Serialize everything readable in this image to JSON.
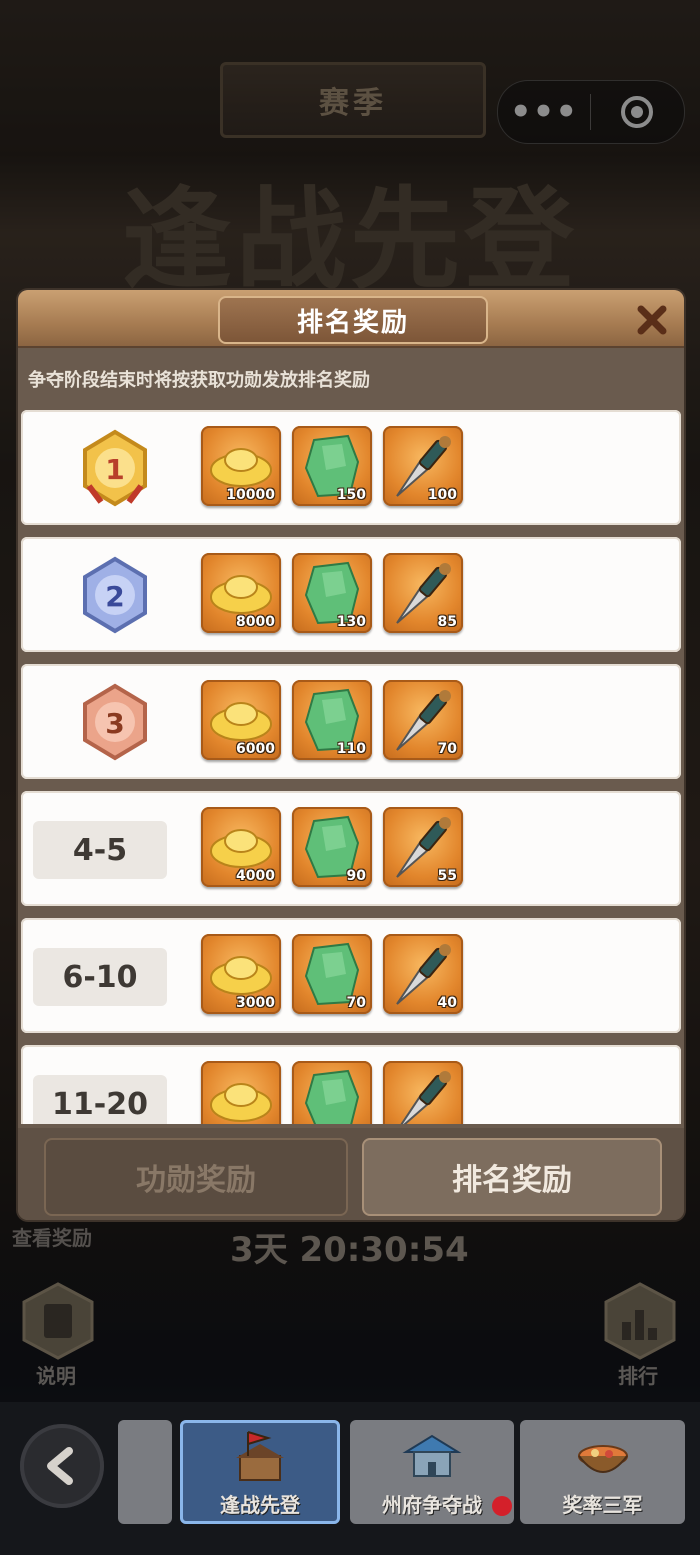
{
  "header": {
    "season_title": "赛季",
    "event_title": "逢战先登",
    "menu_dots": "•••"
  },
  "modal": {
    "title": "排名奖励",
    "description": "争夺阶段结束时将按获取功勋发放排名奖励",
    "rows": [
      {
        "rank": "1",
        "rewards": [
          {
            "item": "gold-ingot-icon",
            "qty": "10000"
          },
          {
            "item": "jade-stone-icon",
            "qty": "150"
          },
          {
            "item": "dagger-icon",
            "qty": "100"
          }
        ]
      },
      {
        "rank": "2",
        "rewards": [
          {
            "item": "gold-ingot-icon",
            "qty": "8000"
          },
          {
            "item": "jade-stone-icon",
            "qty": "130"
          },
          {
            "item": "dagger-icon",
            "qty": "85"
          }
        ]
      },
      {
        "rank": "3",
        "rewards": [
          {
            "item": "gold-ingot-icon",
            "qty": "6000"
          },
          {
            "item": "jade-stone-icon",
            "qty": "110"
          },
          {
            "item": "dagger-icon",
            "qty": "70"
          }
        ]
      },
      {
        "rank": "4-5",
        "rewards": [
          {
            "item": "gold-ingot-icon",
            "qty": "4000"
          },
          {
            "item": "jade-stone-icon",
            "qty": "90"
          },
          {
            "item": "dagger-icon",
            "qty": "55"
          }
        ]
      },
      {
        "rank": "6-10",
        "rewards": [
          {
            "item": "gold-ingot-icon",
            "qty": "3000"
          },
          {
            "item": "jade-stone-icon",
            "qty": "70"
          },
          {
            "item": "dagger-icon",
            "qty": "40"
          }
        ]
      },
      {
        "rank": "11-20",
        "rewards": [
          {
            "item": "gold-ingot-icon",
            "qty": ""
          },
          {
            "item": "jade-stone-icon",
            "qty": ""
          },
          {
            "item": "dagger-icon",
            "qty": ""
          }
        ]
      }
    ],
    "tabs": {
      "merit": "功勋奖励",
      "ranking": "排名奖励"
    }
  },
  "below_modal": {
    "view_rewards": "查看奖励",
    "countdown": "3天 20:30:54",
    "help_label": "说明",
    "rank_label": "排行"
  },
  "bottom_nav": {
    "items": [
      {
        "label": "逢战先登",
        "active": true
      },
      {
        "label": "州府争夺战",
        "active": false
      },
      {
        "label": "奖率三军",
        "active": false
      }
    ]
  },
  "colors": {
    "accent_gold": "#e2862c",
    "modal_bg": "#6a5b4e",
    "active_nav": "#3c5b86"
  }
}
